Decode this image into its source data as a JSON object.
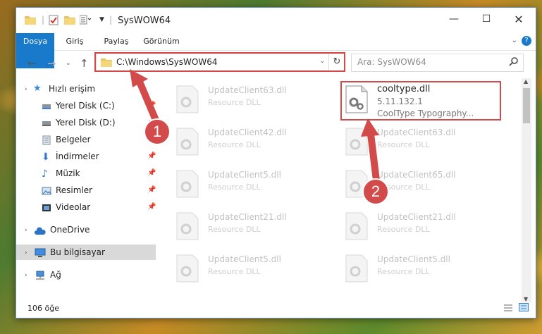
{
  "window": {
    "title": "SysWOW64"
  },
  "controls": {
    "minimize": "—",
    "maximize": "☐",
    "close": "✕",
    "help": "?"
  },
  "ribbon": {
    "tabs": [
      "Dosya",
      "Giriş",
      "Paylaş",
      "Görünüm"
    ]
  },
  "address": {
    "path": "C:\\Windows\\SysWOW64",
    "search_placeholder": "Ara: SysWOW64"
  },
  "sidebar": {
    "items": [
      {
        "label": "Hızlı erişim",
        "icon": "star-icon"
      },
      {
        "label": "Yerel Disk (C:)",
        "icon": "drive-icon",
        "pinned": true
      },
      {
        "label": "Yerel Disk (D:)",
        "icon": "drive-icon",
        "pinned": true
      },
      {
        "label": "Belgeler",
        "icon": "documents-icon",
        "pinned": true
      },
      {
        "label": "İndirmeler",
        "icon": "download-icon",
        "pinned": true
      },
      {
        "label": "Müzik",
        "icon": "music-icon",
        "pinned": true
      },
      {
        "label": "Resimler",
        "icon": "pictures-icon",
        "pinned": true
      },
      {
        "label": "Videolar",
        "icon": "video-icon",
        "pinned": true
      },
      {
        "label": "OneDrive",
        "icon": "cloud-icon"
      },
      {
        "label": "Bu bilgisayar",
        "icon": "computer-icon",
        "selected": true
      },
      {
        "label": "Ağ",
        "icon": "network-icon"
      }
    ]
  },
  "files": [
    {
      "name": "UpdateClient63.dll",
      "desc": "Resource DLL"
    },
    {
      "name": "cooltype.dll",
      "desc": "5.11.132.1",
      "desc2": "CoolType Typography...",
      "highlight": true
    },
    {
      "name": "UpdateClient42.dll",
      "desc": "Resource DLL"
    },
    {
      "name": "UpdateClient63.dll",
      "desc": "Resource DLL"
    },
    {
      "name": "UpdateClient5.dll",
      "desc": "Resource DLL"
    },
    {
      "name": "UpdateClient65.dll",
      "desc": "Resource DLL"
    },
    {
      "name": "UpdateClient21.dll",
      "desc": "Resource DLL"
    },
    {
      "name": "UpdateClient21.dll",
      "desc": "Resource DLL"
    },
    {
      "name": "UpdateClient5.dll",
      "desc": "Resource DLL"
    },
    {
      "name": "UpdateClient5.dll",
      "desc": "Resource DLL"
    }
  ],
  "annotations": {
    "step1": "1",
    "step2": "2",
    "color": "#d24a4a"
  },
  "status": {
    "count": "106 öğe"
  }
}
